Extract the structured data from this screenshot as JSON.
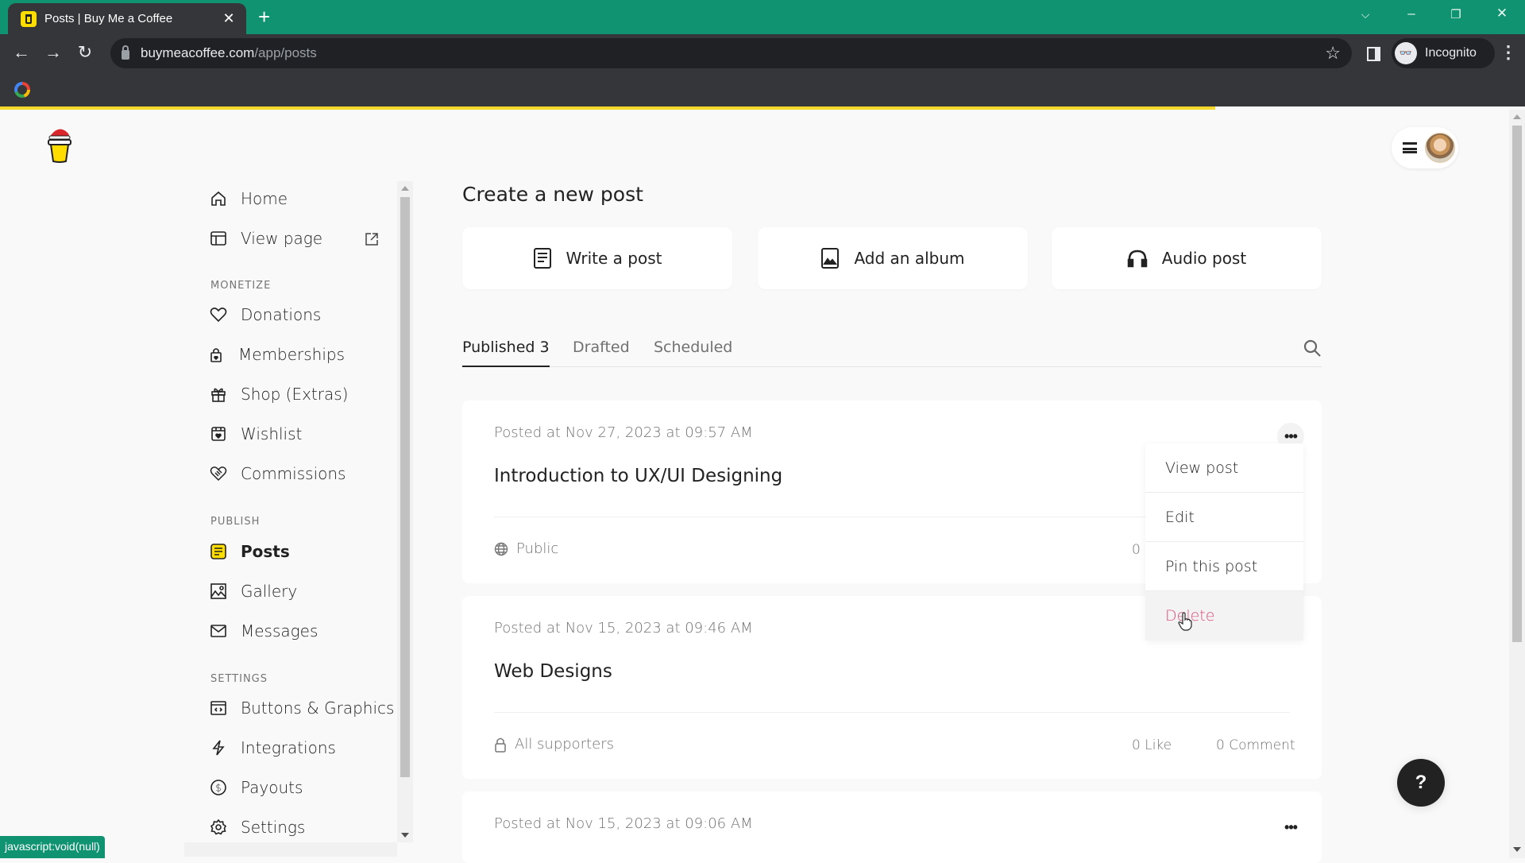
{
  "browser": {
    "tab_title": "Posts | Buy Me a Coffee",
    "new_tab_label": "+",
    "url_host": "buymeacoffee.com",
    "url_path": "/app/posts",
    "profile_label": "Incognito",
    "status_text": "javascript:void(null)"
  },
  "sidebar": {
    "top_items": [
      {
        "label": "Home",
        "icon": "home-icon"
      },
      {
        "label": "View page",
        "icon": "layout-icon"
      }
    ],
    "sections": [
      {
        "heading": "MONETIZE",
        "items": [
          {
            "label": "Donations",
            "icon": "heart-icon"
          },
          {
            "label": "Memberships",
            "icon": "lock-heart-icon"
          },
          {
            "label": "Shop (Extras)",
            "icon": "gift-icon"
          },
          {
            "label": "Wishlist",
            "icon": "wishlist-icon"
          },
          {
            "label": "Commissions",
            "icon": "handshake-icon"
          }
        ]
      },
      {
        "heading": "PUBLISH",
        "items": [
          {
            "label": "Posts",
            "icon": "posts-icon",
            "active": true
          },
          {
            "label": "Gallery",
            "icon": "image-icon"
          },
          {
            "label": "Messages",
            "icon": "mail-icon"
          }
        ]
      },
      {
        "heading": "SETTINGS",
        "items": [
          {
            "label": "Buttons & Graphics",
            "icon": "code-window-icon"
          },
          {
            "label": "Integrations",
            "icon": "lightning-icon"
          },
          {
            "label": "Payouts",
            "icon": "dollar-icon"
          },
          {
            "label": "Settings",
            "icon": "gear-icon"
          }
        ]
      }
    ]
  },
  "main": {
    "create_title": "Create a new post",
    "create_options": [
      {
        "label": "Write a post",
        "icon": "document-icon"
      },
      {
        "label": "Add an album",
        "icon": "image-icon"
      },
      {
        "label": "Audio post",
        "icon": "headphones-icon"
      }
    ],
    "tabs": [
      {
        "label": "Published 3",
        "active": true
      },
      {
        "label": "Drafted",
        "active": false
      },
      {
        "label": "Scheduled",
        "active": false
      }
    ],
    "posts": [
      {
        "posted": "Posted at Nov 27, 2023 at 09:57 AM",
        "title": "Introduction to UX/UI Designing",
        "visibility": "Public",
        "visibility_icon": "globe-icon",
        "likes": "0",
        "comments": ""
      },
      {
        "posted": "Posted at Nov 15, 2023 at 09:46 AM",
        "title": "Web Designs",
        "visibility": "All supporters",
        "visibility_icon": "lock-icon",
        "likes": "0 Like",
        "comments": "0 Comment"
      },
      {
        "posted": "Posted at Nov 15, 2023 at 09:06 AM"
      }
    ],
    "post_menu": [
      {
        "label": "View post"
      },
      {
        "label": "Edit"
      },
      {
        "label": "Pin this post"
      },
      {
        "label": "Delete",
        "danger": true
      }
    ],
    "help_label": "?"
  },
  "colors": {
    "brand_yellow": "#ffdd00",
    "chrome_green": "#0f9371",
    "danger": "#d9517f"
  }
}
